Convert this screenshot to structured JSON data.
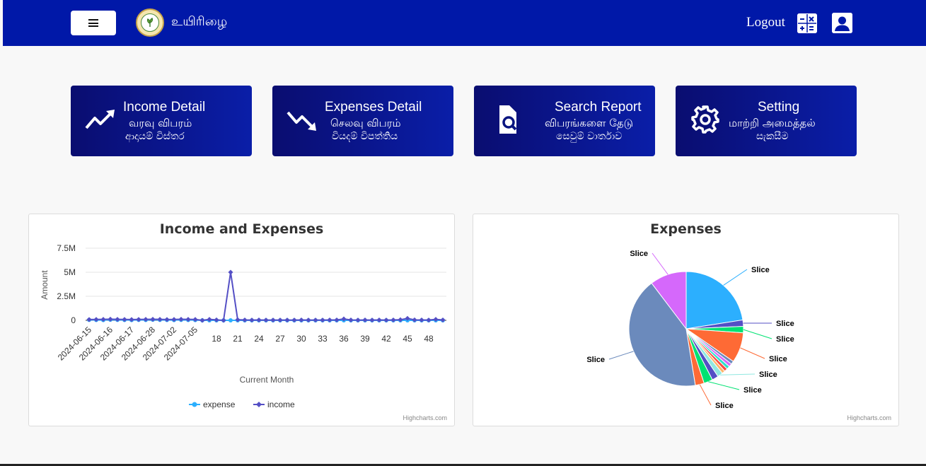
{
  "header": {
    "brand": "உயிரிழை",
    "logout_label": "Logout",
    "bg_color": "#0018a8"
  },
  "tiles": [
    {
      "title": "Income Detail",
      "sub1": "வரவு விபரம்",
      "sub2": "ආදායම් විස්තර",
      "icon": "trending-up-icon"
    },
    {
      "title": "Expenses Detail",
      "sub1": "செலவு விபரம்",
      "sub2": "වියදම් විපත්තිය",
      "icon": "trending-down-icon"
    },
    {
      "title": "Search Report",
      "sub1": "விபரங்களை தேடு",
      "sub2": "සෙවුම් වාර්තාව",
      "icon": "search-file-icon"
    },
    {
      "title": "Setting",
      "sub1": "மாற்றி அமைத்தல்",
      "sub2": "සැකසීම",
      "icon": "gear-icon"
    }
  ],
  "income_card": {
    "credits": "Highcharts.com"
  },
  "expenses_card": {
    "credits": "Highcharts.com"
  },
  "chart_data": [
    {
      "type": "line",
      "title": "Income and Expenses",
      "xlabel": "Current Month",
      "ylabel": "Amount",
      "ylim": [
        0,
        7500000
      ],
      "yticks": [
        0,
        2500000,
        5000000,
        7500000
      ],
      "ytick_labels": [
        "0",
        "2.5M",
        "5M",
        "7.5M"
      ],
      "xtick_labels": [
        "2024-06-15",
        "2024-06-16",
        "2024-06-17",
        "2024-06-28",
        "2024-07-02",
        "2024-07-05",
        "18",
        "21",
        "24",
        "27",
        "30",
        "33",
        "36",
        "39",
        "42",
        "45",
        "48"
      ],
      "legend": "bottom",
      "grid": true,
      "series": [
        {
          "name": "expense",
          "color": "#2caffe",
          "values": [
            50000,
            40000,
            30000,
            60000,
            50000,
            40000,
            30000,
            50000,
            40000,
            60000,
            50000,
            40000,
            30000,
            50000,
            40000,
            30000,
            0,
            0,
            0,
            0,
            0,
            0,
            0,
            0,
            0,
            0,
            0,
            0,
            0,
            0,
            0,
            0,
            0,
            0,
            0,
            0,
            0,
            0,
            0,
            0,
            0,
            0,
            0,
            0,
            0,
            0,
            0,
            0,
            0,
            0,
            0
          ]
        },
        {
          "name": "income",
          "color": "#544fc5",
          "values": [
            80000,
            90000,
            100000,
            120000,
            100000,
            90000,
            80000,
            90000,
            100000,
            110000,
            100000,
            80000,
            90000,
            110000,
            100000,
            90000,
            0,
            100000,
            50000,
            0,
            5000000,
            60000,
            40000,
            30000,
            40000,
            30000,
            30000,
            30000,
            30000,
            30000,
            40000,
            30000,
            30000,
            30000,
            40000,
            40000,
            150000,
            40000,
            30000,
            40000,
            30000,
            40000,
            30000,
            40000,
            60000,
            200000,
            50000,
            40000,
            30000,
            100000,
            40000
          ]
        }
      ]
    },
    {
      "type": "pie",
      "title": "Expenses",
      "slices": [
        {
          "name": "Slice",
          "value": 22.5,
          "color": "#2caffe"
        },
        {
          "name": "Slice",
          "value": 1.8,
          "color": "#544fc5"
        },
        {
          "name": "Slice",
          "value": 1.8,
          "color": "#00e272"
        },
        {
          "name": "Slice",
          "value": 8.5,
          "color": "#fe6a35"
        },
        {
          "name": "Slice",
          "value": 0.9,
          "color": "#6b8abc"
        },
        {
          "name": "Slice",
          "value": 0.9,
          "color": "#d568fb"
        },
        {
          "name": "Slice",
          "value": 0.9,
          "color": "#2ee0ca"
        },
        {
          "name": "Slice",
          "value": 0.9,
          "color": "#fa4b42"
        },
        {
          "name": "Slice",
          "value": 0.9,
          "color": "#feb56a"
        },
        {
          "name": "Slice",
          "value": 1.5,
          "color": "#91e8e1"
        },
        {
          "name": "Slice",
          "value": 1.8,
          "color": "#544fc5"
        },
        {
          "name": "Slice",
          "value": 2.5,
          "color": "#00e272"
        },
        {
          "name": "Slice",
          "value": 2.5,
          "color": "#fe6a35"
        },
        {
          "name": "Slice",
          "value": 42.2,
          "color": "#6b8abc"
        },
        {
          "name": "Slice",
          "value": 10.3,
          "color": "#d568fb"
        }
      ]
    }
  ]
}
